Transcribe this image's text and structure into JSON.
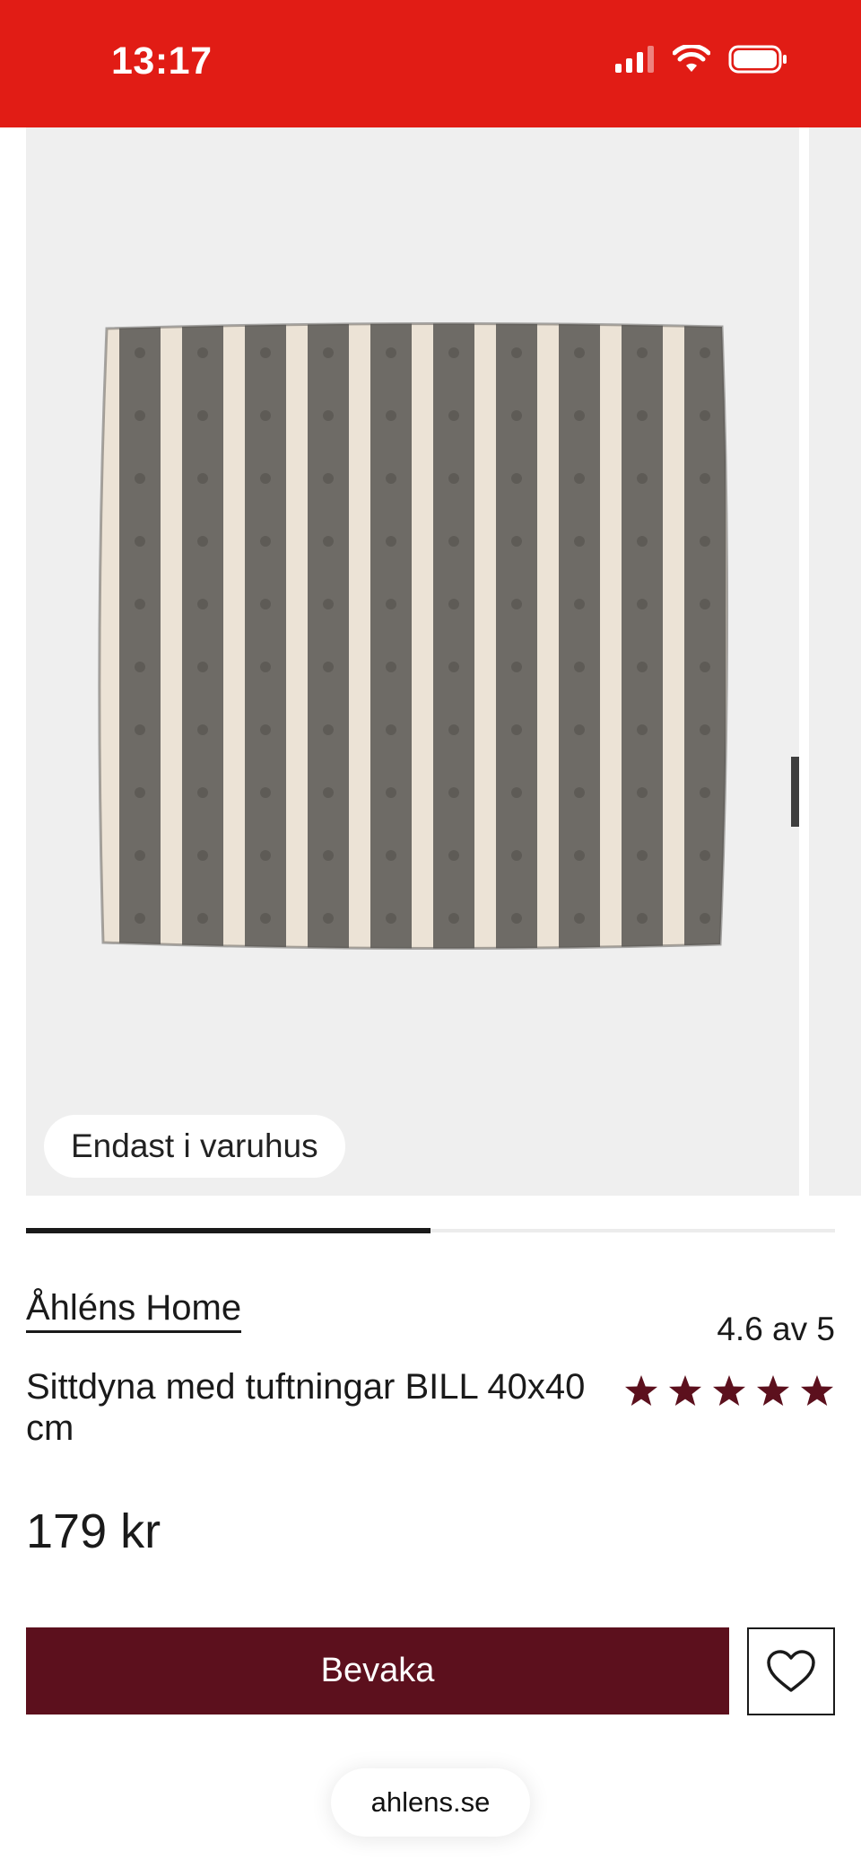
{
  "status_bar": {
    "time": "13:17",
    "icons": [
      "signal-icon",
      "wifi-icon",
      "battery-icon"
    ],
    "background": "#e11c15"
  },
  "gallery": {
    "badge": "Endast i varuhus",
    "next_icon": "arrow-right-icon",
    "progress": 0.5
  },
  "product": {
    "brand": "Åhléns Home",
    "name": "Sittdyna med tuftningar BILL 40x40 cm",
    "rating_text": "4.6 av 5",
    "rating": 4.6,
    "star_color": "#5c101d",
    "price": "179 kr"
  },
  "actions": {
    "watch_label": "Bevaka",
    "watch_color": "#5c101d",
    "wishlist_icon": "heart-icon"
  },
  "browser": {
    "url": "ahlens.se"
  }
}
